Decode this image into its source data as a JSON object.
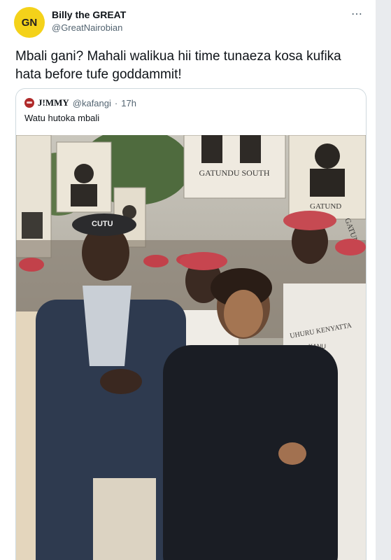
{
  "author": {
    "avatar_initials": "GN",
    "display_name": "Billy the GREAT",
    "handle": "@GreatNairobian"
  },
  "more_icon": "⋯",
  "tweet": {
    "text": "Mbali gani? Mahali walikua hii time tunaeza kosa kufika hata before tufe goddammit!"
  },
  "quoted": {
    "display_name": "J!MMY",
    "handle": "@kafangi",
    "separator": "·",
    "time": "17h",
    "text": "Watu hutoka mbali"
  },
  "photo": {
    "signs": [
      "GATUNDU SOUTH",
      "GATUNDU",
      "GATUND",
      "KANU",
      "UHURU KENYATTA"
    ],
    "cap_text": "CUTU"
  },
  "colors": {
    "avatar_bg": "#f4d21a",
    "text": "#0f1419",
    "muted": "#536471",
    "border": "#cfd9de"
  }
}
